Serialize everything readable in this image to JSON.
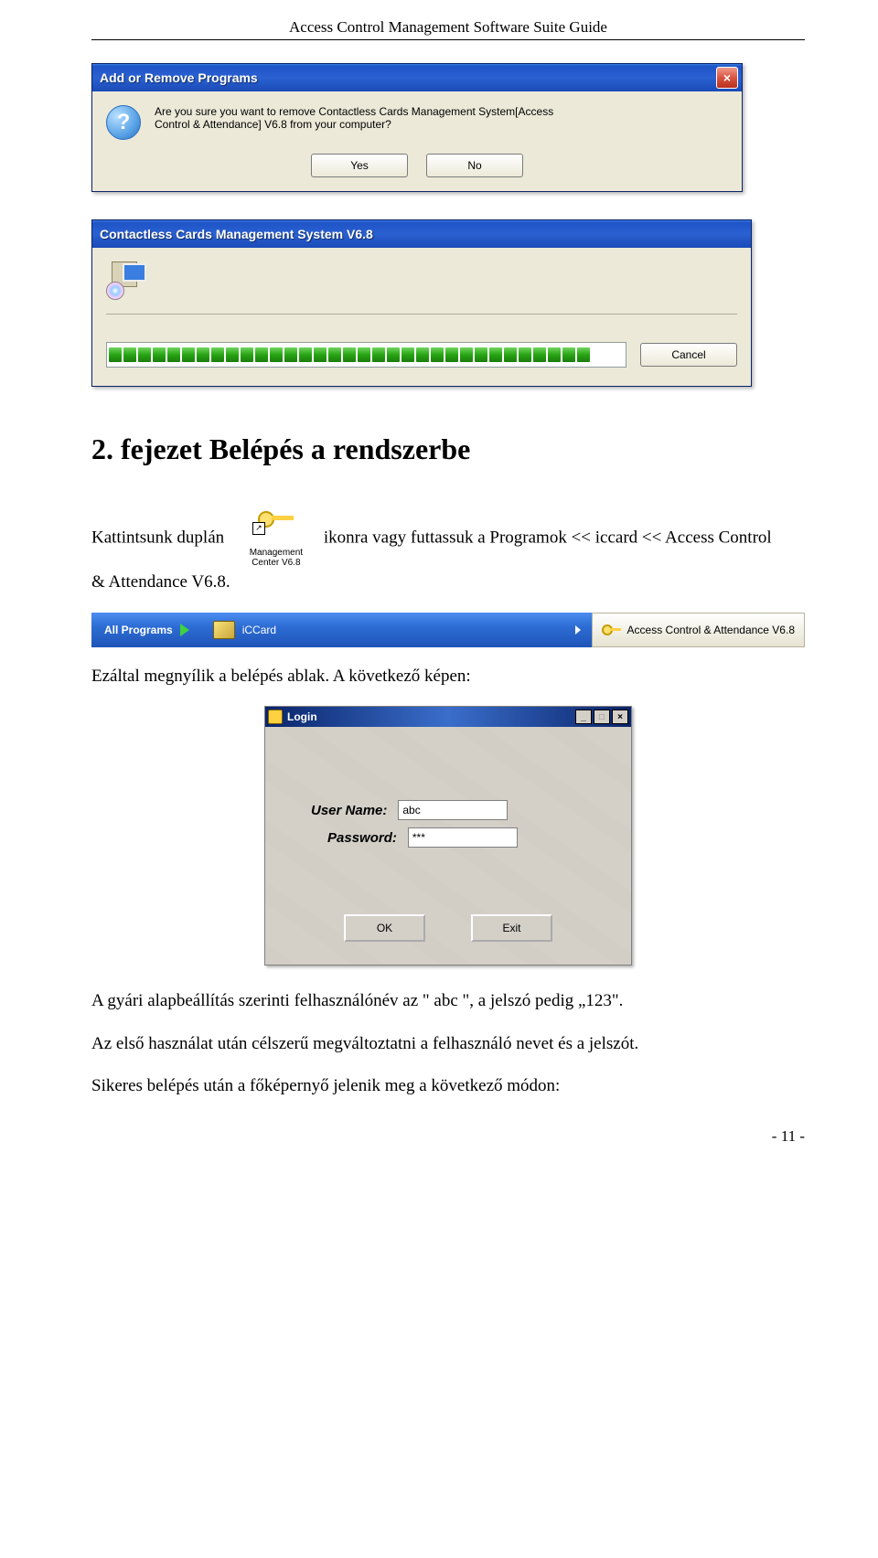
{
  "header": {
    "title": "Access Control Management Software Suite Guide"
  },
  "dialog1": {
    "title": "Add or Remove Programs",
    "message_line1": "Are you sure you want to remove Contactless Cards Management System[Access",
    "message_line2": "Control & Attendance] V6.8 from your computer?",
    "yes": "Yes",
    "no": "No"
  },
  "dialog2": {
    "title": "Contactless Cards Management System V6.8",
    "cancel": "Cancel"
  },
  "chapter": {
    "heading": "2. fejezet Belépés a rendszerbe"
  },
  "p1": {
    "before": "Kattintsunk duplán ",
    "icon_label_line1": "Management",
    "icon_label_line2": "Center V6.8",
    "icon_arrow": "↗",
    "after1": "ikonra vagy futtassuk a Programok << iccard << Access Control",
    "line2": "& Attendance V6.8."
  },
  "startbar": {
    "all_programs": "All Programs",
    "iccard": "iCCard",
    "access": "Access Control & Attendance V6.8"
  },
  "p2": "Ezáltal megnyílik a belépés ablak. A következő képen:",
  "login": {
    "title": "Login",
    "user_label": "User Name:",
    "pass_label": "Password:",
    "user_value": "abc",
    "pass_value": "***",
    "ok": "OK",
    "exit": "Exit",
    "min": "_",
    "max": "□",
    "close": "×"
  },
  "p3": "A gyári alapbeállítás szerinti felhasználónév az \" abc \", a jelszó pedig „123\".",
  "p4": "Az első használat után célszerű megváltoztatni a felhasználó nevet és a jelszót.",
  "p5": "Sikeres belépés után a főképernyő jelenik meg a következő módon:",
  "pagenum": "- 11 -"
}
